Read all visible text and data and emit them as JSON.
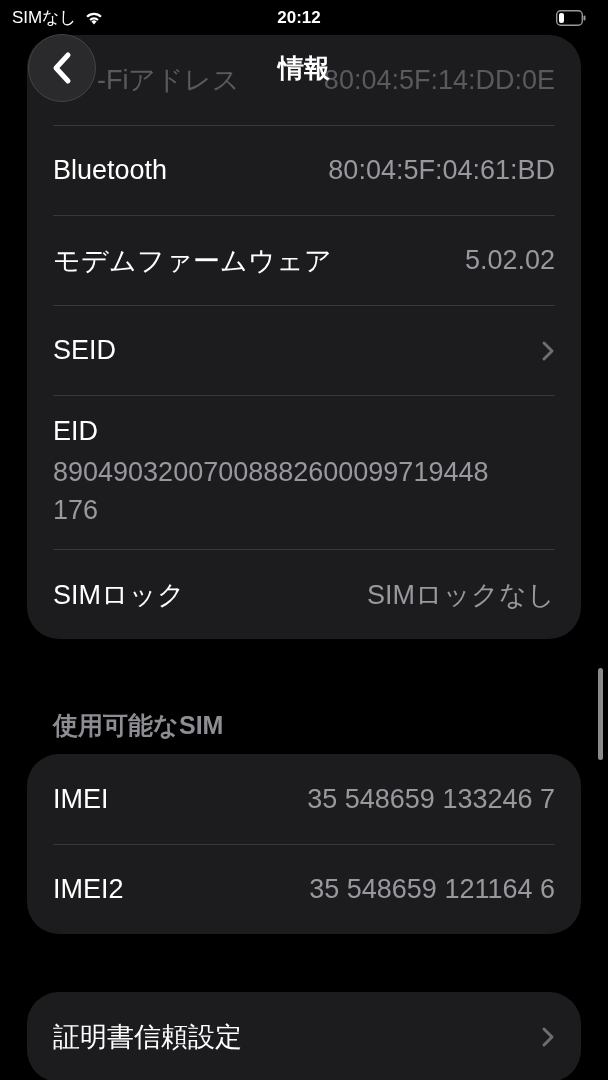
{
  "status_bar": {
    "carrier": "SIMなし",
    "time": "20:12"
  },
  "nav": {
    "title": "情報"
  },
  "groups": [
    {
      "rows": [
        {
          "kind": "obscured",
          "label": "-Fiアドレス",
          "value": "80:04:5F:14:DD:0E"
        },
        {
          "kind": "value",
          "label": "Bluetooth",
          "value": "80:04:5F:04:61:BD"
        },
        {
          "kind": "value",
          "label": "モデムファームウェア",
          "value": "5.02.02"
        },
        {
          "kind": "link",
          "label": "SEID"
        },
        {
          "kind": "stacked",
          "label": "EID",
          "value": "89049032007008882600099719448176"
        },
        {
          "kind": "value",
          "label": "SIMロック",
          "value": "SIMロックなし"
        }
      ]
    },
    {
      "header": "使用可能なSIM",
      "rows": [
        {
          "kind": "value",
          "label": "IMEI",
          "value": "35 548659 133246 7"
        },
        {
          "kind": "value",
          "label": "IMEI2",
          "value": "35 548659 121164 6"
        }
      ]
    },
    {
      "rows": [
        {
          "kind": "link",
          "label": "証明書信頼設定"
        }
      ]
    }
  ]
}
